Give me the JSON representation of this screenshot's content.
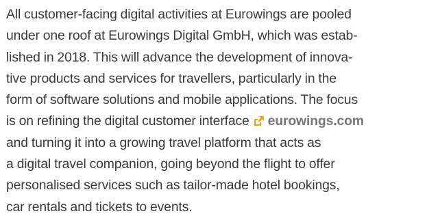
{
  "article": {
    "lines": [
      "All customer-facing digital activities at Eurowings are pooled",
      "under one roof at Eurowings Digital GmbH, which was estab-",
      "lished in 2018. This will advance the development of innova-",
      "tive products and services for travellers, particularly in the",
      "form of software solutions and mobile applications. The focus",
      "is on refining the digital customer interface",
      "and turning it into a growing travel platform that acts as",
      "a digital travel companion, going beyond the flight to offer",
      "personalised services such as tailor-made hotel bookings,",
      "car rentals and tickets to events."
    ],
    "link": {
      "label": "eurowings.com",
      "icon": "external-link-icon",
      "icon_color": "#f5a300",
      "color": "#777777"
    },
    "text_color": "#3a3a3a"
  }
}
